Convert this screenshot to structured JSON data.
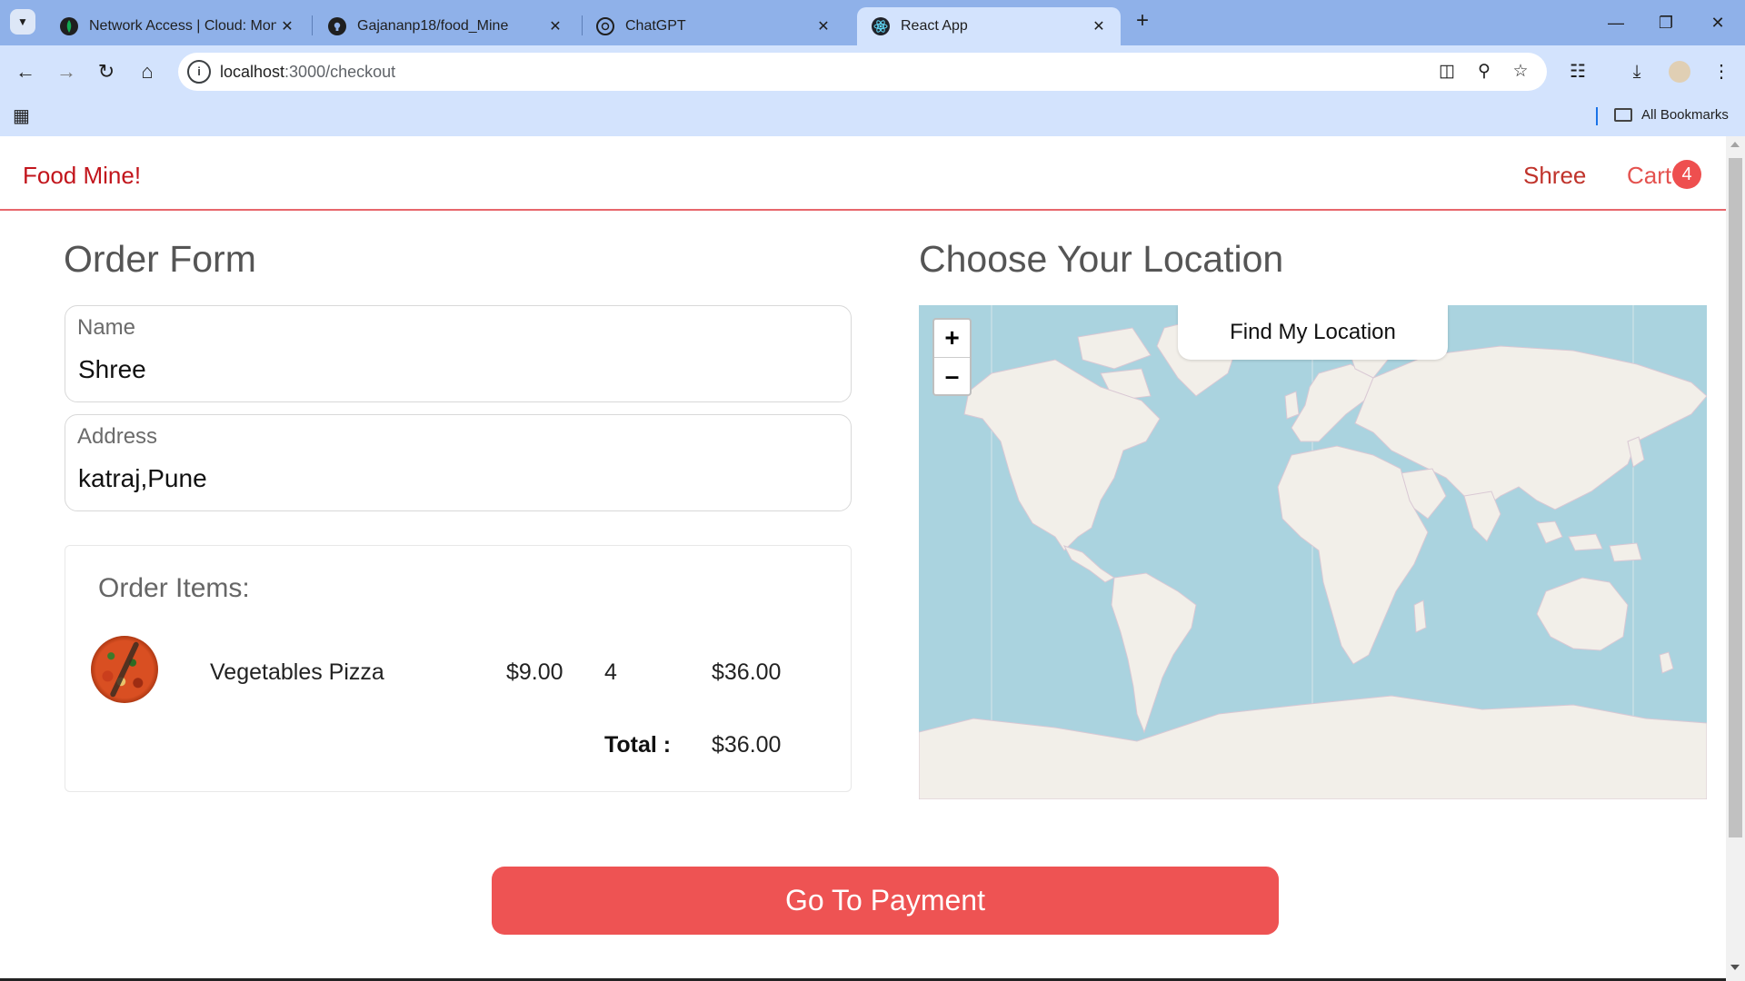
{
  "browser": {
    "tabs": [
      {
        "title": "Network Access | Cloud: MongoDB",
        "icon": "mongodb-leaf-icon"
      },
      {
        "title": "Gajananp18/food_Mine",
        "icon": "github-icon"
      },
      {
        "title": "ChatGPT",
        "icon": "chatgpt-icon"
      },
      {
        "title": "React App",
        "icon": "react-icon",
        "active": true
      }
    ],
    "url_host": "localhost",
    "url_path": ":3000/checkout",
    "bookmarks_label": "All Bookmarks"
  },
  "header": {
    "logo": "Food Mine!",
    "user": "Shree",
    "cart_label": "Cart",
    "cart_count": "4"
  },
  "order_form": {
    "title": "Order Form",
    "name_label": "Name",
    "name_value": "Shree",
    "address_label": "Address",
    "address_value": "katraj,Pune"
  },
  "order_items": {
    "title": "Order Items:",
    "items": [
      {
        "name": "Vegetables Pizza",
        "price": "$9.00",
        "quantity": "4",
        "subtotal": "$36.00",
        "image": "vegetables-pizza"
      }
    ],
    "total_label": "Total :",
    "total_value": "$36.00"
  },
  "location": {
    "title": "Choose Your Location",
    "find_button": "Find My Location",
    "zoom_in": "+",
    "zoom_out": "–",
    "colors": {
      "water": "#aad3df",
      "land": "#f2efe9"
    }
  },
  "payment": {
    "button_label": "Go To Payment",
    "color": "#ee5353"
  }
}
